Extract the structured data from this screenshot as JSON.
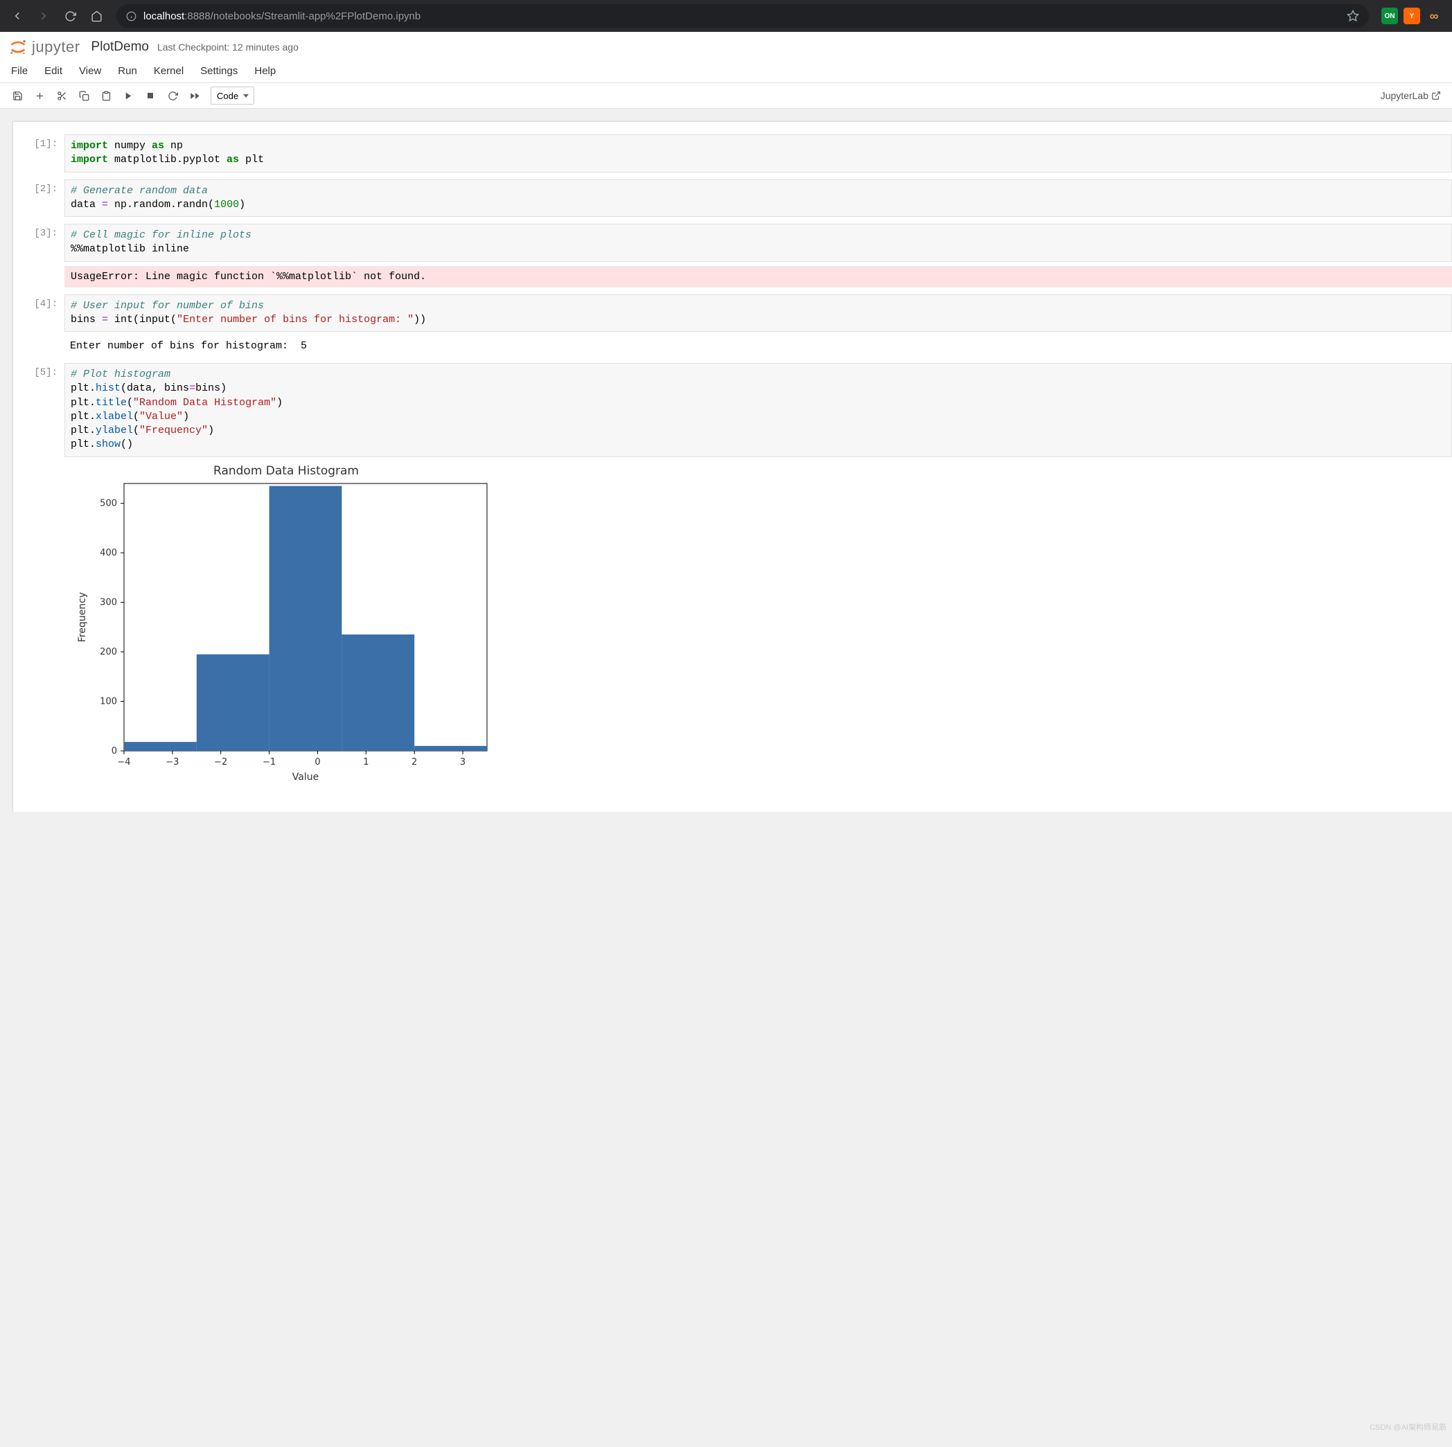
{
  "browser": {
    "url_host": "localhost",
    "url_rest": ":8888/notebooks/Streamlit-app%2FPlotDemo.ipynb",
    "extensions": {
      "on_label": "ON",
      "y_label": "Y"
    }
  },
  "header": {
    "logo_text": "jupyter",
    "notebook_title": "PlotDemo",
    "checkpoint": "Last Checkpoint: 12 minutes ago"
  },
  "menu": [
    "File",
    "Edit",
    "View",
    "Run",
    "Kernel",
    "Settings",
    "Help"
  ],
  "toolbar": {
    "cell_type": "Code",
    "jupyterlab": "JupyterLab"
  },
  "cells": [
    {
      "prompt": "[1]:",
      "code_html": "<span class='kw'>import</span> numpy <span class='kw'>as</span> np\n<span class='kw'>import</span> matplotlib.pyplot <span class='kw'>as</span> plt"
    },
    {
      "prompt": "[2]:",
      "code_html": "<span class='cmt'># Generate random data</span>\ndata <span class='op'>=</span> np.random.randn(<span class='num'>1000</span>)"
    },
    {
      "prompt": "[3]:",
      "code_html": "<span class='cmt'># Cell magic for inline plots</span>\n%%matplotlib inline",
      "error": "UsageError: Line magic function `%%matplotlib` not found."
    },
    {
      "prompt": "[4]:",
      "code_html": "<span class='cmt'># User input for number of bins</span>\nbins <span class='op'>=</span> int(input(<span class='str'>\"Enter number of bins for histogram: \"</span>))",
      "stream": "Enter number of bins for histogram:  5"
    },
    {
      "prompt": "[5]:",
      "code_html": "<span class='cmt'># Plot histogram</span>\nplt.<span class='fn'>hist</span>(data, bins<span class='op'>=</span>bins)\nplt.<span class='fn'>title</span>(<span class='str'>\"Random Data Histogram\"</span>)\nplt.<span class='fn'>xlabel</span>(<span class='str'>\"Value\"</span>)\nplt.<span class='fn'>ylabel</span>(<span class='str'>\"Frequency\"</span>)\nplt.<span class='fn'>show</span>()"
    }
  ],
  "chart_data": {
    "type": "bar",
    "title": "Random Data Histogram",
    "xlabel": "Value",
    "ylabel": "Frequency",
    "categories": [
      "-4..-2.5",
      "-2.5..-1",
      "-1..0.5",
      "0.5..2",
      "2..3.5"
    ],
    "bin_edges": [
      -4,
      -2.5,
      -1,
      0.5,
      2,
      3.5
    ],
    "values": [
      18,
      195,
      535,
      235,
      10
    ],
    "xlim": [
      -4,
      3.5
    ],
    "ylim": [
      0,
      540
    ],
    "xticks": [
      -4,
      -3,
      -2,
      -1,
      0,
      1,
      2,
      3
    ],
    "yticks": [
      0,
      100,
      200,
      300,
      400,
      500
    ],
    "bar_color": "#3a6fa8"
  },
  "watermark": "CSDN @AI架构师易筋"
}
